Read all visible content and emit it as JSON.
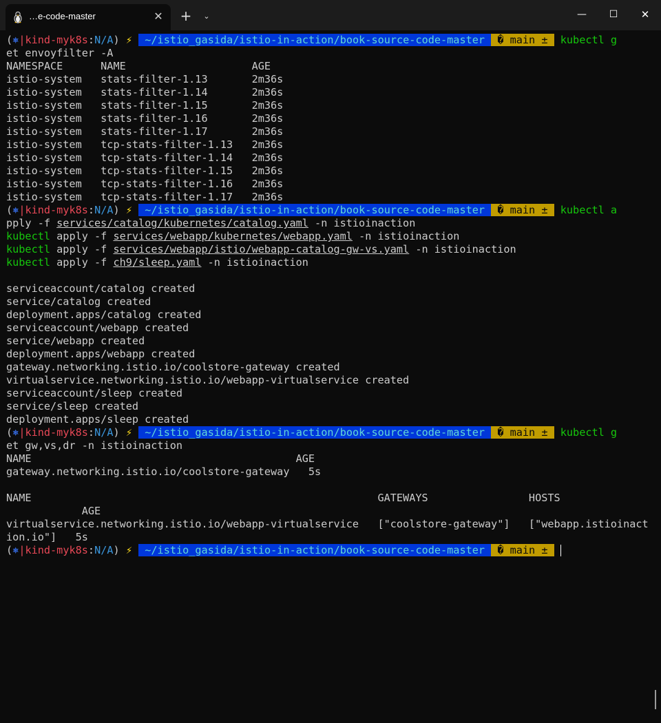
{
  "window": {
    "tab_title": "…e-code-master",
    "tab_icon": "linux-penguin-icon",
    "tab_close": "✕",
    "new_tab": "+",
    "dropdown": "⌄",
    "minimize": "—",
    "maximize": "☐",
    "close": "✕"
  },
  "prompt": {
    "open_paren": "(",
    "k8s_icon": "⎈",
    "pipe": "|",
    "context": "kind-myk8s",
    "colon": ":",
    "namespace": "N/A",
    "close_paren": ")",
    "bolt": "⚡",
    "path": " ~/istio_gasida/istio-in-action/book-source-code-master ",
    "arrow": "",
    "git": " � main ± "
  },
  "block1": {
    "cmd_tail": "kubectl g",
    "cmd_wrap": "et envoyfilter -A",
    "header": "NAMESPACE      NAME                    AGE",
    "rows": [
      "istio-system   stats-filter-1.13       2m36s",
      "istio-system   stats-filter-1.14       2m36s",
      "istio-system   stats-filter-1.15       2m36s",
      "istio-system   stats-filter-1.16       2m36s",
      "istio-system   stats-filter-1.17       2m36s",
      "istio-system   tcp-stats-filter-1.13   2m36s",
      "istio-system   tcp-stats-filter-1.14   2m36s",
      "istio-system   tcp-stats-filter-1.15   2m36s",
      "istio-system   tcp-stats-filter-1.16   2m36s",
      "istio-system   tcp-stats-filter-1.17   2m36s"
    ]
  },
  "block2": {
    "cmd_tail": "kubectl a",
    "l1_pre": "pply -f ",
    "l1_file": "services/catalog/kubernetes/catalog.yaml",
    "l1_post": " -n istioinaction",
    "kubectl": "kubectl",
    "apply_f": " apply -f ",
    "l2_file": "services/webapp/kubernetes/webapp.yaml",
    "l3_file": "services/webapp/istio/webapp-catalog-gw-vs.yaml",
    "l4_file": "ch9/sleep.yaml",
    "ns_flag": " -n istioinaction",
    "output": [
      "serviceaccount/catalog created",
      "service/catalog created",
      "deployment.apps/catalog created",
      "serviceaccount/webapp created",
      "service/webapp created",
      "deployment.apps/webapp created",
      "gateway.networking.istio.io/coolstore-gateway created",
      "virtualservice.networking.istio.io/webapp-virtualservice created",
      "serviceaccount/sleep created",
      "service/sleep created",
      "deployment.apps/sleep created"
    ]
  },
  "block3": {
    "cmd_tail": "kubectl g",
    "cmd_wrap": "et gw,vs,dr -n istioinaction",
    "gw_header": "NAME                                          AGE",
    "gw_row": "gateway.networking.istio.io/coolstore-gateway   5s",
    "vs_header": "NAME                                                       GATEWAYS                HOSTS",
    "vs_header_wrap": "            AGE",
    "vs_row": "virtualservice.networking.istio.io/webapp-virtualservice   [\"coolstore-gateway\"]   [\"webapp.istioinact",
    "vs_row_wrap": "ion.io\"]   5s"
  }
}
